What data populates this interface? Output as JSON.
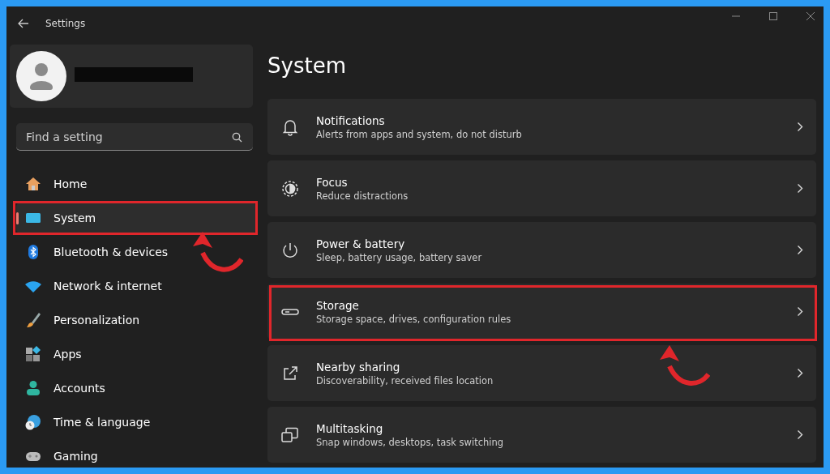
{
  "window": {
    "title": "Settings"
  },
  "account": {
    "redacted": true
  },
  "search": {
    "placeholder": "Find a setting"
  },
  "sidebar": {
    "items": [
      {
        "label": "Home",
        "selected": false,
        "highlighted": false
      },
      {
        "label": "System",
        "selected": true,
        "highlighted": true
      },
      {
        "label": "Bluetooth & devices",
        "selected": false,
        "highlighted": false
      },
      {
        "label": "Network & internet",
        "selected": false,
        "highlighted": false
      },
      {
        "label": "Personalization",
        "selected": false,
        "highlighted": false
      },
      {
        "label": "Apps",
        "selected": false,
        "highlighted": false
      },
      {
        "label": "Accounts",
        "selected": false,
        "highlighted": false
      },
      {
        "label": "Time & language",
        "selected": false,
        "highlighted": false
      },
      {
        "label": "Gaming",
        "selected": false,
        "highlighted": false
      }
    ]
  },
  "page": {
    "title": "System",
    "cards": [
      {
        "title": "Notifications",
        "subtitle": "Alerts from apps and system, do not disturb",
        "highlighted": false
      },
      {
        "title": "Focus",
        "subtitle": "Reduce distractions",
        "highlighted": false
      },
      {
        "title": "Power & battery",
        "subtitle": "Sleep, battery usage, battery saver",
        "highlighted": false
      },
      {
        "title": "Storage",
        "subtitle": "Storage space, drives, configuration rules",
        "highlighted": true
      },
      {
        "title": "Nearby sharing",
        "subtitle": "Discoverability, received files location",
        "highlighted": false
      },
      {
        "title": "Multitasking",
        "subtitle": "Snap windows, desktops, task switching",
        "highlighted": false
      }
    ]
  }
}
